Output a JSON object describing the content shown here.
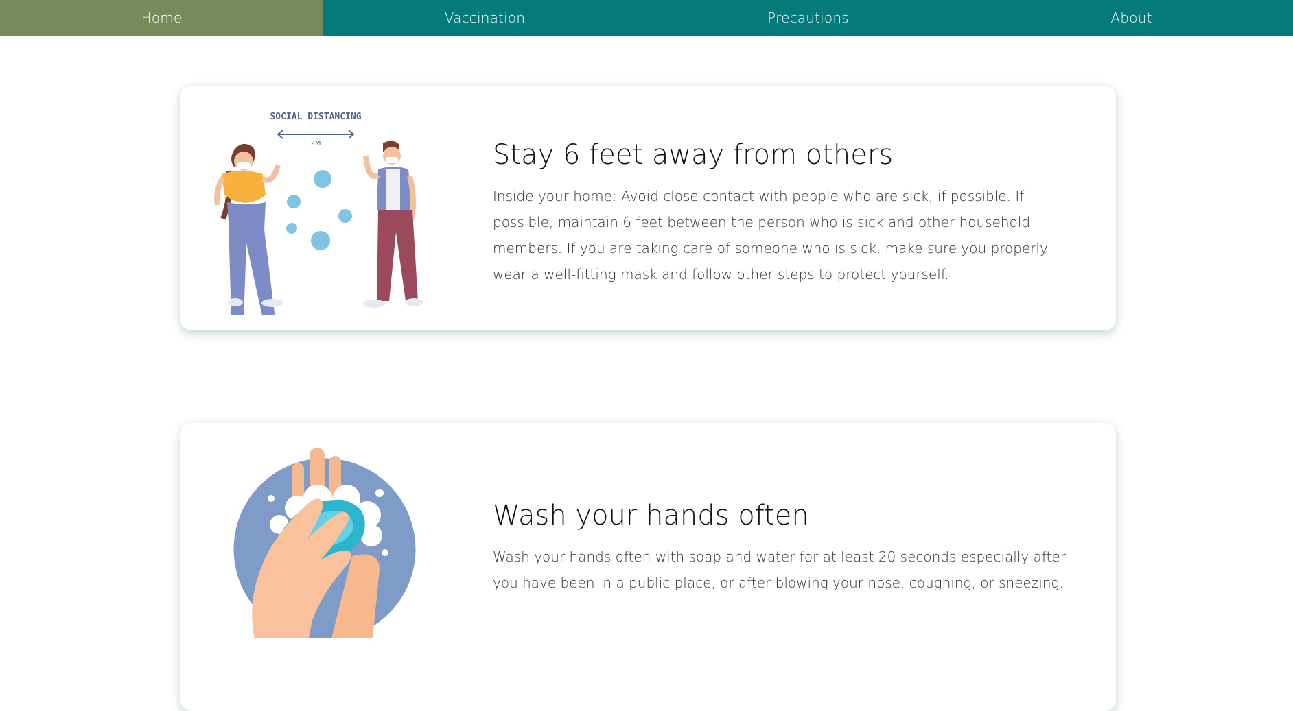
{
  "nav": {
    "items": [
      {
        "label": "Home",
        "active": true
      },
      {
        "label": "Vaccination",
        "active": false
      },
      {
        "label": "Precautions",
        "active": false
      },
      {
        "label": "About",
        "active": false
      }
    ]
  },
  "colors": {
    "nav_background": "#057a7a",
    "nav_active": "#768b5b",
    "virus": "#7fc4e0",
    "hands_circle": "#7f9cc9",
    "soap": "#2db4cf"
  },
  "cards": [
    {
      "title": "Stay 6 feet away from others",
      "text": "Inside your home: Avoid close contact with people who are sick, if possible. If possible, maintain 6 feet between the person who is sick and other household members. If you are taking care of someone who is sick, make sure you properly wear a well-fitting mask and follow other steps to protect yourself.",
      "illustration": {
        "label": "SOCIAL DISTANCING",
        "distance": "2M"
      }
    },
    {
      "title": "Wash your hands often",
      "text": "Wash your hands often with soap and water for at least 20 seconds especially after you have been in a public place, or after blowing your nose, coughing, or sneezing."
    }
  ]
}
